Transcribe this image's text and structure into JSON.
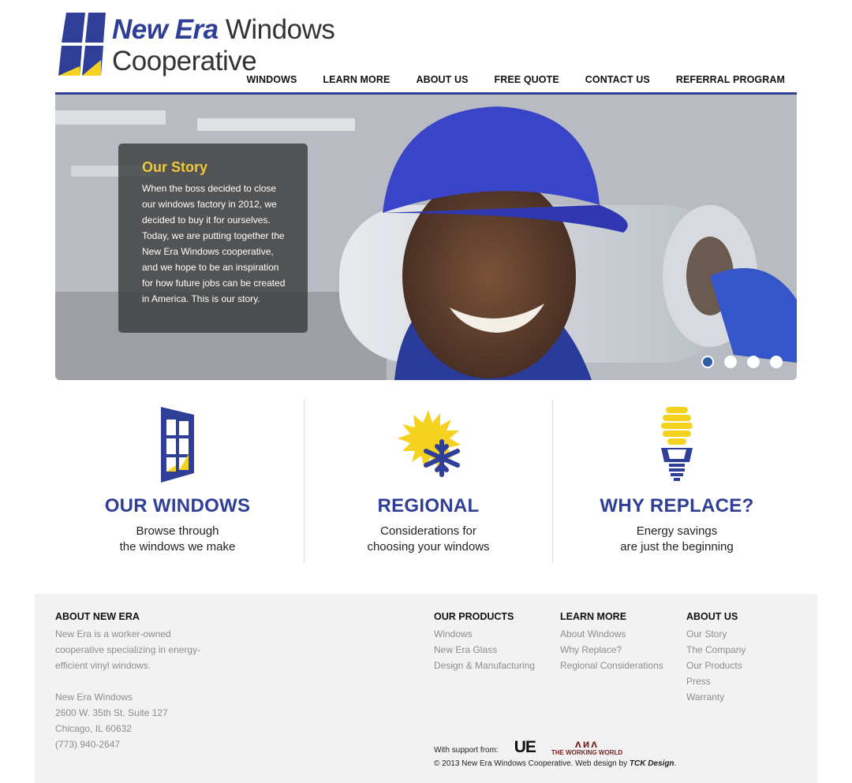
{
  "brand": {
    "name_bold": "New Era",
    "name_light": "Windows",
    "name_line2": "Cooperative",
    "primary_color": "#2f3f97",
    "accent_color": "#f0c93a"
  },
  "nav": {
    "items": [
      "WINDOWS",
      "LEARN MORE",
      "ABOUT US",
      "FREE QUOTE",
      "CONTACT US",
      "REFERRAL PROGRAM"
    ]
  },
  "hero": {
    "story_title": "Our Story",
    "story_text": "When the boss decided to close our windows factory in 2012, we decided to buy it for ourselves. Today, we are putting together the New Era Windows cooperative, and we hope to be an inspiration for how future jobs can be created in America. This is our story.",
    "slides_total": 4,
    "active_slide": 1
  },
  "features": [
    {
      "icon": "window-icon",
      "title": "OUR WINDOWS",
      "line1": "Browse through",
      "line2": "the windows we make"
    },
    {
      "icon": "sun-snowflake-icon",
      "title": "REGIONAL",
      "line1": "Considerations for",
      "line2": "choosing your windows"
    },
    {
      "icon": "lightbulb-icon",
      "title": "WHY REPLACE?",
      "line1": "Energy savings",
      "line2": "are just the beginning"
    }
  ],
  "footer": {
    "about_title": "ABOUT NEW ERA",
    "about_text": "New Era is a worker-owned cooperative specializing in energy-efficient vinyl windows.",
    "address_name": "New Era Windows",
    "address_street": "2600 W. 35th St. Suite 127",
    "address_city": "Chicago, IL 60632",
    "address_phone": "(773) 940-2647",
    "products_title": "OUR PRODUCTS",
    "products": [
      "Windows",
      "New Era Glass",
      "Design & Manufacturing"
    ],
    "learn_title": "LEARN MORE",
    "learn": [
      "About Windows",
      "Why Replace?",
      "Regional Considerations"
    ],
    "aboutus_title": "ABOUT US",
    "aboutus": [
      "Our Story",
      "The Company",
      "Our Products",
      "Press",
      "Warranty"
    ],
    "support_label": "With support from:",
    "ue_logo": "UE",
    "tww_logo": "THE WORKING WORLD",
    "copyright_prefix": "© 2013 New Era Windows Cooperative. Web design by ",
    "designer": "TCK Design",
    "copyright_suffix": "."
  }
}
